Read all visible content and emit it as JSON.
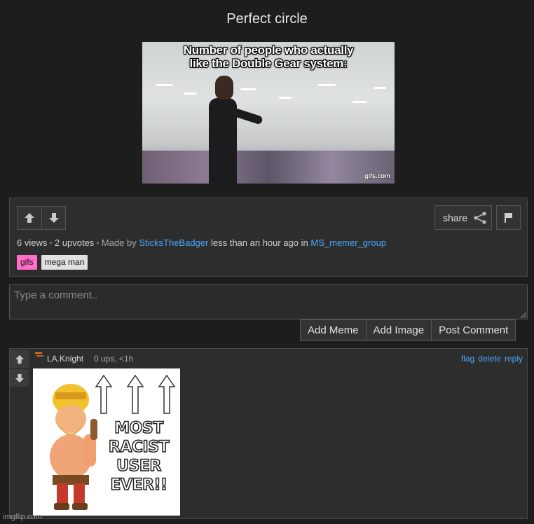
{
  "post": {
    "title": "Perfect circle",
    "image": {
      "caption_line1": "Number of people who actually",
      "caption_line2": "like the Double Gear system:",
      "watermark": "gifs.com"
    },
    "share_label": "share",
    "stats": {
      "views": "6 views",
      "upvotes": "2 upvotes",
      "made_by_prefix": "Made by",
      "author": "SticksTheBadger",
      "time": "less than an hour ago in",
      "stream": "MS_memer_group"
    },
    "tags": [
      {
        "label": "gifs",
        "color": "#ff6ec7"
      },
      {
        "label": "mega man",
        "color": "#e0e0e0"
      }
    ]
  },
  "comment_form": {
    "placeholder": "Type a comment..",
    "buttons": [
      "Add Meme",
      "Add Image",
      "Post Comment"
    ]
  },
  "comments": [
    {
      "user": "LA.Knight",
      "meta": "0 ups, <1h",
      "actions": [
        "flag",
        "delete",
        "reply"
      ],
      "image_text": [
        "MOST",
        "RACIST",
        "USER",
        "EVER!!"
      ]
    }
  ],
  "footer": {
    "watermark": "imgflip.com"
  },
  "colors": {
    "background": "#1d1d1d",
    "panel": "#2d2d2d",
    "link": "#4aa8ff",
    "tag_gifs": "#ff6ec7"
  },
  "icons": {
    "upvote": "arrow-up-icon",
    "downvote": "arrow-down-icon",
    "share": "share-icon",
    "flag": "flag-icon"
  }
}
